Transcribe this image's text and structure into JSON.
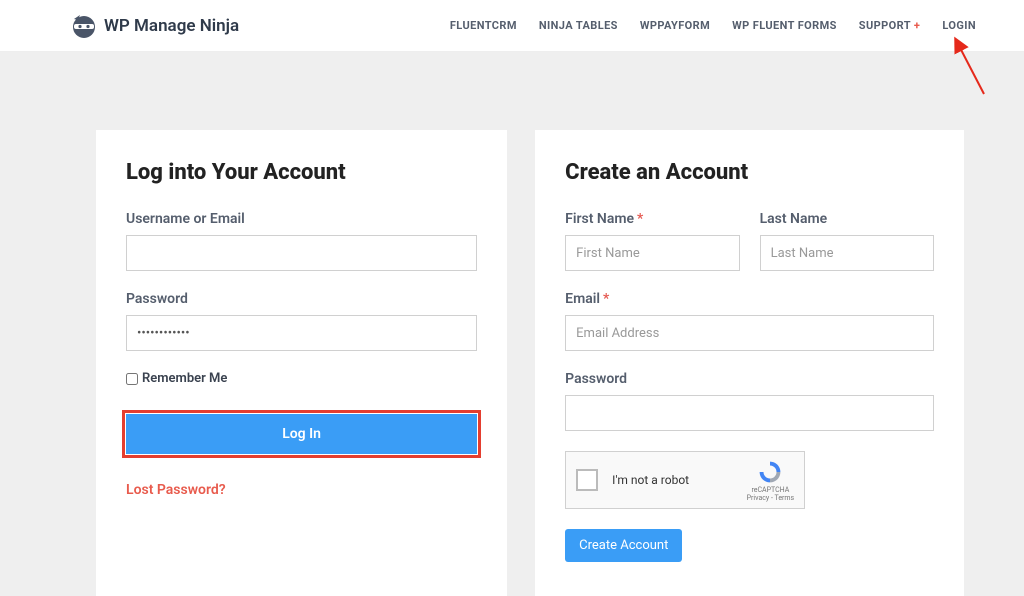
{
  "brand": {
    "name": "WP Manage Ninja"
  },
  "nav": {
    "items": [
      "FLUENTCRM",
      "NINJA TABLES",
      "WPPAYFORM",
      "WP FLUENT FORMS"
    ],
    "support": "SUPPORT",
    "login": "LOGIN"
  },
  "login": {
    "title": "Log into Your Account",
    "username_label": "Username or Email",
    "username_value": "",
    "password_label": "Password",
    "password_value": "••••••••••••",
    "remember_label": "Remember Me",
    "button": "Log In",
    "lost": "Lost Password?"
  },
  "register": {
    "title": "Create an Account",
    "first_name_label": "First Name",
    "first_name_placeholder": "First Name",
    "last_name_label": "Last Name",
    "last_name_placeholder": "Last Name",
    "email_label": "Email",
    "email_placeholder": "Email Address",
    "password_label": "Password",
    "captcha_text": "I'm not a robot",
    "captcha_badge_top": "reCAPTCHA",
    "captcha_badge_bottom": "Privacy - Terms",
    "button": "Create Account"
  }
}
